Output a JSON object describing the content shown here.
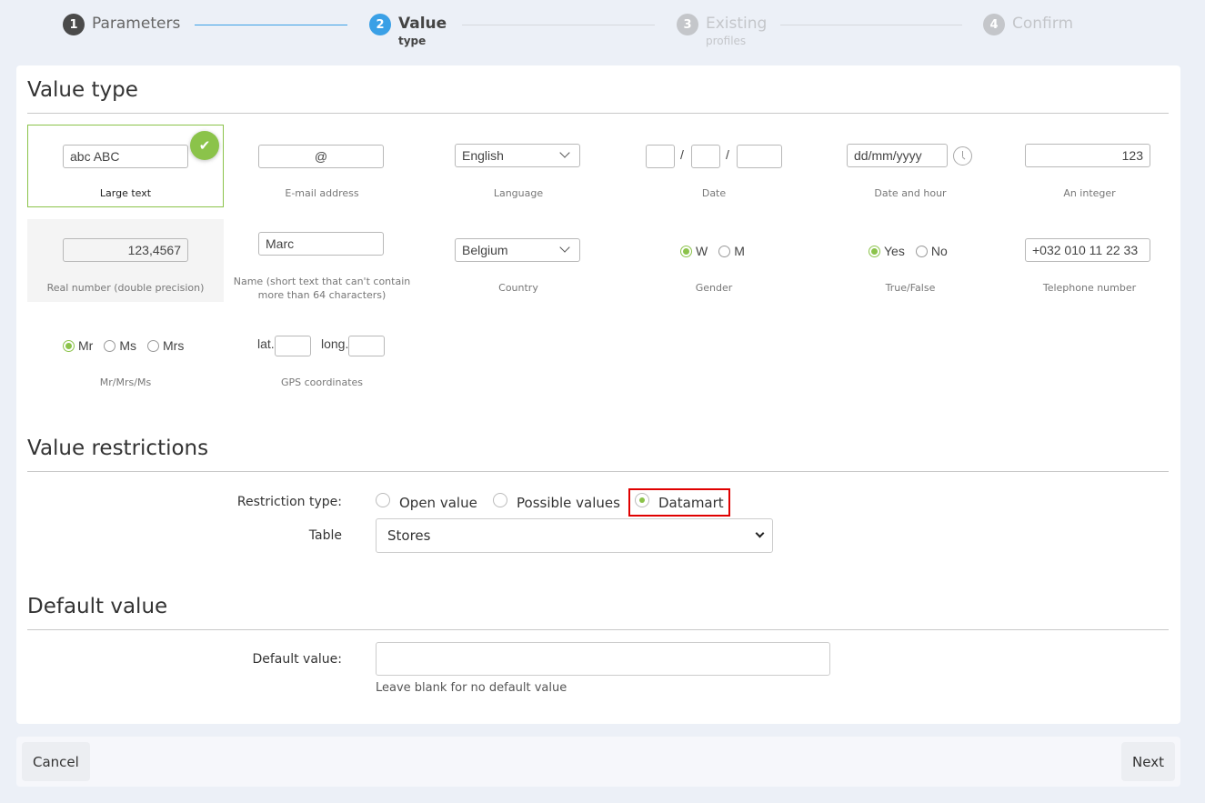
{
  "stepper": {
    "steps": [
      {
        "number": "1",
        "label": "Parameters",
        "sub": "",
        "state": "done"
      },
      {
        "number": "2",
        "label": "Value",
        "sub": "type",
        "state": "active"
      },
      {
        "number": "3",
        "label": "Existing",
        "sub": "profiles",
        "state": "todo"
      },
      {
        "number": "4",
        "label": "Confirm",
        "sub": "",
        "state": "todo"
      }
    ]
  },
  "value_type": {
    "title": "Value type",
    "tiles": {
      "large_text": {
        "value": "abc ABC",
        "caption": "Large text",
        "selected": true
      },
      "email": {
        "value": "@",
        "caption": "E-mail address"
      },
      "language": {
        "value": "English",
        "caption": "Language"
      },
      "date": {
        "separator": "/",
        "caption": "Date"
      },
      "date_hour": {
        "value": "dd/mm/yyyy",
        "caption": "Date and hour"
      },
      "integer": {
        "value": "123",
        "caption": "An integer"
      },
      "real": {
        "value": "123,4567",
        "caption": "Real number (double precision)"
      },
      "name": {
        "value": "Marc",
        "caption": "Name (short text that can't contain more than 64 characters)"
      },
      "country": {
        "value": "Belgium",
        "caption": "Country"
      },
      "gender": {
        "options": [
          "W",
          "M"
        ],
        "selected": "W",
        "caption": "Gender"
      },
      "true_false": {
        "options": [
          "Yes",
          "No"
        ],
        "selected": "Yes",
        "caption": "True/False"
      },
      "telephone": {
        "value": "+032 010 11 22 33",
        "caption": "Telephone number"
      },
      "title": {
        "options": [
          "Mr",
          "Ms",
          "Mrs"
        ],
        "selected": "Mr",
        "caption": "Mr/Mrs/Ms"
      },
      "gps": {
        "lat_label": "lat.",
        "long_label": "long.",
        "caption": "GPS coordinates"
      }
    }
  },
  "value_restrictions": {
    "title": "Value restrictions",
    "restriction_type_label": "Restriction type:",
    "options": [
      "Open value",
      "Possible values",
      "Datamart"
    ],
    "selected": "Datamart",
    "table_label": "Table",
    "table_value": "Stores"
  },
  "default_value": {
    "title": "Default value",
    "label": "Default value:",
    "value": "",
    "help": "Leave blank for no default value"
  },
  "footer": {
    "cancel_label": "Cancel",
    "next_label": "Next"
  }
}
